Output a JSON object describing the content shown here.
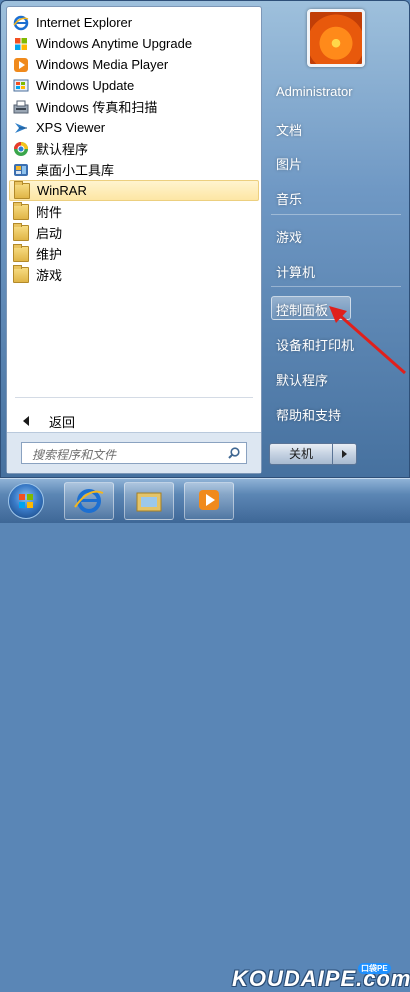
{
  "programs": [
    {
      "label": "Internet Explorer",
      "icon": "internet-explorer-icon"
    },
    {
      "label": "Windows Anytime Upgrade",
      "icon": "windows-flag-icon"
    },
    {
      "label": "Windows Media Player",
      "icon": "media-player-icon"
    },
    {
      "label": "Windows Update",
      "icon": "windows-update-icon"
    },
    {
      "label": "Windows 传真和扫描",
      "icon": "fax-scanner-icon"
    },
    {
      "label": "XPS Viewer",
      "icon": "xps-viewer-icon"
    },
    {
      "label": "默认程序",
      "icon": "default-programs-icon"
    },
    {
      "label": "桌面小工具库",
      "icon": "gadgets-icon"
    },
    {
      "label": "WinRAR",
      "icon": "folder-icon",
      "selected": true
    },
    {
      "label": "附件",
      "icon": "folder-icon"
    },
    {
      "label": "启动",
      "icon": "folder-icon"
    },
    {
      "label": "维护",
      "icon": "folder-icon"
    },
    {
      "label": "游戏",
      "icon": "folder-icon"
    }
  ],
  "back_label": "返回",
  "search": {
    "placeholder": "搜索程序和文件"
  },
  "right_menu": {
    "user": "Administrator",
    "documents": "文档",
    "pictures": "图片",
    "music": "音乐",
    "games": "游戏",
    "computer": "计算机",
    "control_panel": "控制面板",
    "devices_printers": "设备和打印机",
    "default_programs": "默认程序",
    "help": "帮助和支持"
  },
  "shutdown_label": "关机",
  "watermark": {
    "text": "KOUDAIPE.com",
    "badge": "口袋PE"
  },
  "colors": {
    "selected_bg": "#fde6a4",
    "frame": "#6f98c4",
    "arrow": "#e0201c"
  }
}
